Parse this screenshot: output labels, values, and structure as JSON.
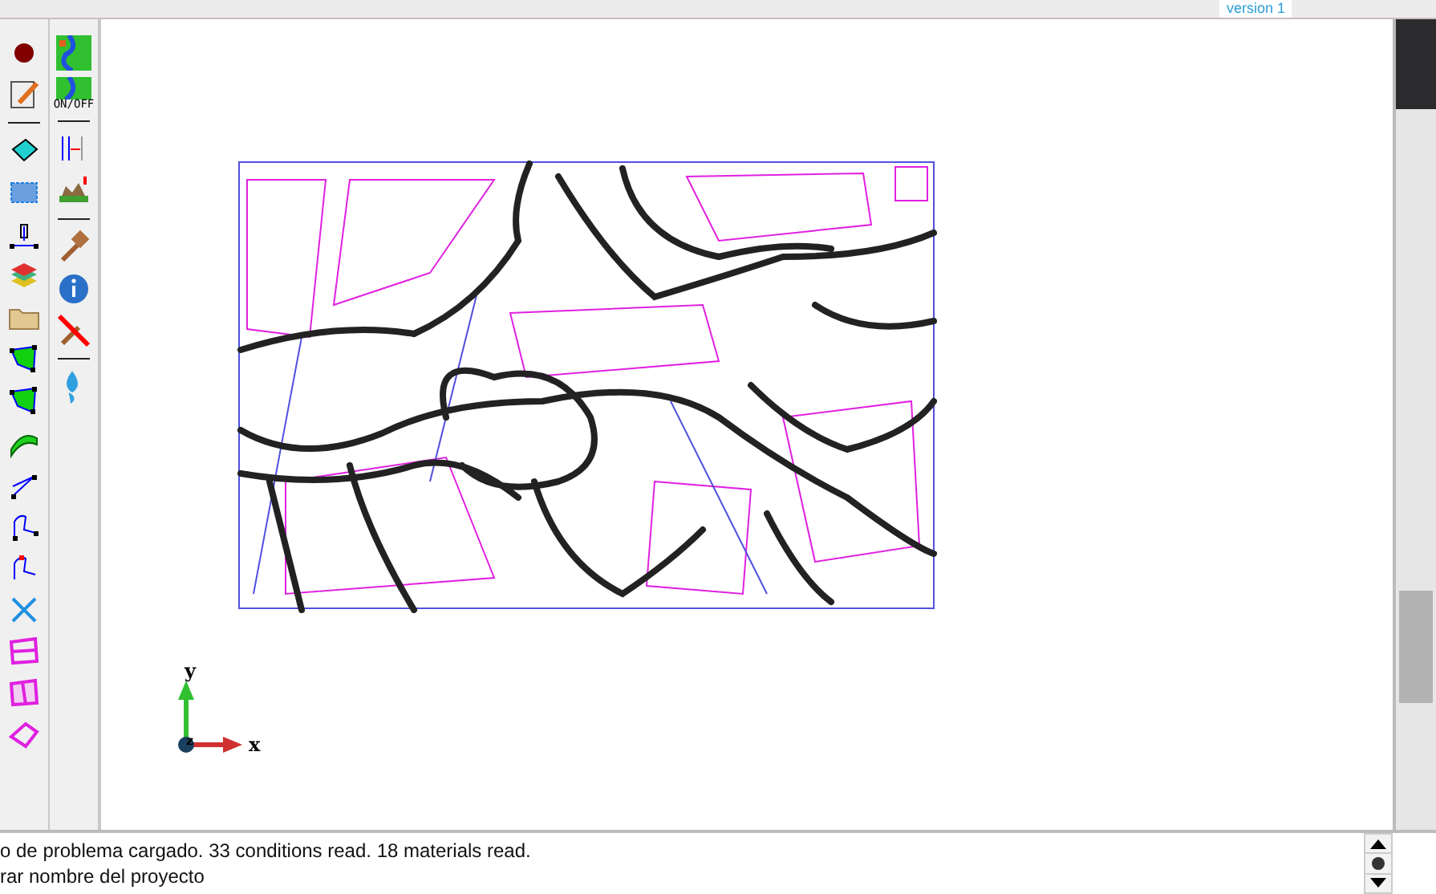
{
  "top_toolbar": {
    "version_label": "version 1"
  },
  "side_toolbar": {
    "onoff_label": "ON/OFF"
  },
  "axes": {
    "x": "x",
    "y": "y",
    "z": "z"
  },
  "messages": [
    "o de problema cargado. 33 conditions read. 18 materials read.",
    "rar nombre del proyecto"
  ]
}
